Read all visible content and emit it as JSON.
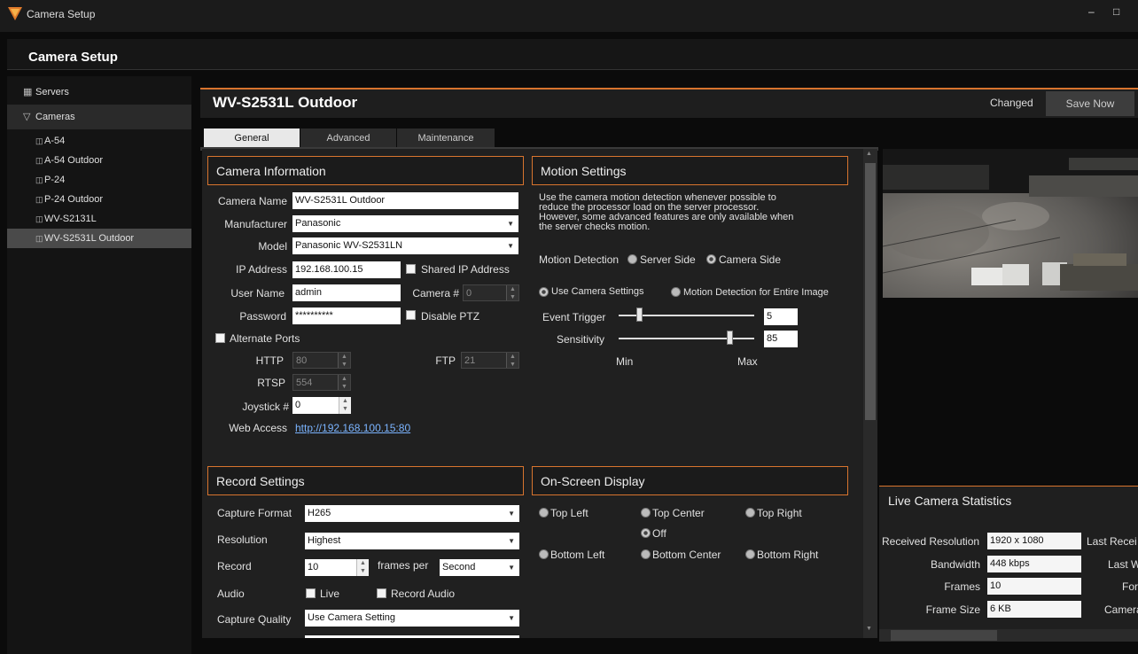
{
  "window": {
    "title": "Camera Setup",
    "minimize": "–",
    "maximize": "□"
  },
  "header": {
    "title": "Camera Setup"
  },
  "sidebar": {
    "groups": [
      {
        "label": "Servers",
        "icon": "servers-icon"
      },
      {
        "label": "Cameras",
        "icon": "cameras-icon"
      }
    ],
    "cameras": [
      "A-54",
      "A-54 Outdoor",
      "P-24",
      "P-24 Outdoor",
      "WV-S2131L",
      "WV-S2531L Outdoor"
    ],
    "selected": "WV-S2531L Outdoor"
  },
  "camera": {
    "title": "WV-S2531L Outdoor",
    "status": "Changed",
    "save_label": "Save Now"
  },
  "tabs": [
    "General",
    "Advanced",
    "Maintenance"
  ],
  "active_tab": "General",
  "camera_info": {
    "title": "Camera Information",
    "camera_name_label": "Camera Name",
    "camera_name": "WV-S2531L Outdoor",
    "manufacturer_label": "Manufacturer",
    "manufacturer": "Panasonic",
    "model_label": "Model",
    "model": "Panasonic WV-S2531LN",
    "ip_label": "IP Address",
    "ip": "192.168.100.15",
    "shared_ip_label": "Shared IP Address",
    "user_label": "User Name",
    "user": "admin",
    "camera_num_label": "Camera #",
    "camera_num": "0",
    "password_label": "Password",
    "password": "**********",
    "disable_ptz_label": "Disable PTZ",
    "alt_ports_label": "Alternate Ports",
    "http_label": "HTTP",
    "http": "80",
    "ftp_label": "FTP",
    "ftp": "21",
    "rtsp_label": "RTSP",
    "rtsp": "554",
    "joystick_label": "Joystick #",
    "joystick": "0",
    "web_access_label": "Web Access",
    "web_access": "http://192.168.100.15:80"
  },
  "motion": {
    "title": "Motion Settings",
    "description": [
      "Use the camera motion detection whenever possible to",
      "reduce the processor load on the server processor.",
      "However, some advanced features are only available when",
      "the server checks motion."
    ],
    "detection_label": "Motion Detection",
    "server_side": "Server Side",
    "camera_side": "Camera Side",
    "use_camera_settings": "Use Camera Settings",
    "entire_image": "Motion Detection for Entire Image",
    "event_trigger_label": "Event Trigger",
    "event_trigger": "5",
    "sensitivity_label": "Sensitivity",
    "sensitivity": "85",
    "min_label": "Min",
    "max_label": "Max"
  },
  "record": {
    "title": "Record Settings",
    "capture_format_label": "Capture Format",
    "capture_format": "H265",
    "resolution_label": "Resolution",
    "resolution": "Highest",
    "record_label": "Record",
    "record_value": "10",
    "frames_per_label": "frames per",
    "frames_unit": "Second",
    "audio_label": "Audio",
    "live_label": "Live",
    "record_audio_label": "Record Audio",
    "capture_quality_label": "Capture Quality",
    "capture_quality": "Use Camera Setting"
  },
  "osd": {
    "title": "On-Screen Display",
    "top_left": "Top Left",
    "top_center": "Top Center",
    "top_right": "Top Right",
    "off": "Off",
    "bottom_left": "Bottom Left",
    "bottom_center": "Bottom Center",
    "bottom_right": "Bottom Right"
  },
  "stats": {
    "title": "Live Camera Statistics",
    "received_resolution_label": "Received Resolution",
    "received_resolution": "1920 x 1080",
    "bandwidth_label": "Bandwidth",
    "bandwidth": "448 kbps",
    "frames_label": "Frames",
    "frames": "10",
    "frame_size_label": "Frame Size",
    "frame_size": "6 KB",
    "last_received_label": "Last Recei",
    "last_w_label": "Last W",
    "for_label": "For",
    "camera_label": "Camera"
  },
  "colors": {
    "accent": "#d8742e",
    "link": "#7bb4ff",
    "background": "#0b0b0b"
  }
}
